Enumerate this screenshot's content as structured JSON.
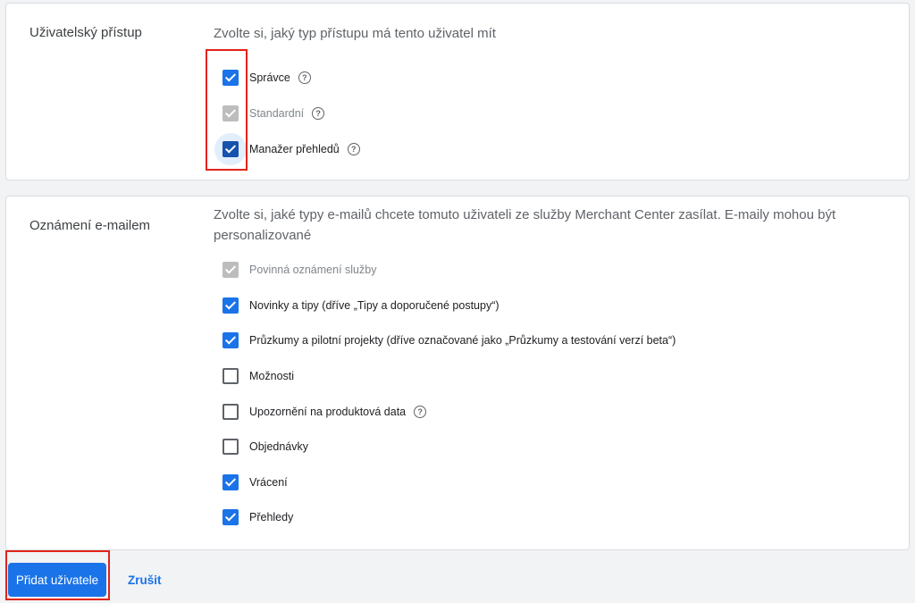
{
  "access": {
    "title": "Uživatelský přístup",
    "description": "Zvolte si, jaký typ přístupu má tento uživatel mít",
    "options": [
      {
        "label": "Správce",
        "checked": true,
        "disabled": false,
        "help": true
      },
      {
        "label": "Standardní",
        "checked": true,
        "disabled": true,
        "help": true
      },
      {
        "label": "Manažer přehledů",
        "checked": true,
        "disabled": false,
        "help": true
      }
    ]
  },
  "email": {
    "title": "Oznámení e-mailem",
    "description": "Zvolte si, jaké typy e-mailů chcete tomuto uživateli ze služby Merchant Center zasílat. E-maily mohou být personalizované",
    "options": [
      {
        "label": "Povinná oznámení služby",
        "checked": true,
        "disabled": true
      },
      {
        "label": "Novinky a tipy (dříve „Tipy a doporučené postupy“)",
        "checked": true,
        "disabled": false
      },
      {
        "label": "Průzkumy a pilotní projekty (dříve označované jako „Průzkumy a testování verzí beta“)",
        "checked": true,
        "disabled": false
      },
      {
        "label": "Možnosti",
        "checked": false,
        "disabled": false
      },
      {
        "label": "Upozornění na produktová data",
        "checked": false,
        "disabled": false,
        "help": true
      },
      {
        "label": "Objednávky",
        "checked": false,
        "disabled": false
      },
      {
        "label": "Vrácení",
        "checked": true,
        "disabled": false
      },
      {
        "label": "Přehledy",
        "checked": true,
        "disabled": false
      }
    ]
  },
  "actions": {
    "add_label": "Přidat uživatele",
    "cancel_label": "Zrušit"
  },
  "icons": {
    "help": "help-circle-icon",
    "check": "checkmark-icon"
  },
  "colors": {
    "accent": "#1a73e8",
    "highlight": "#e2231a",
    "disabled": "#bdbdbd"
  }
}
